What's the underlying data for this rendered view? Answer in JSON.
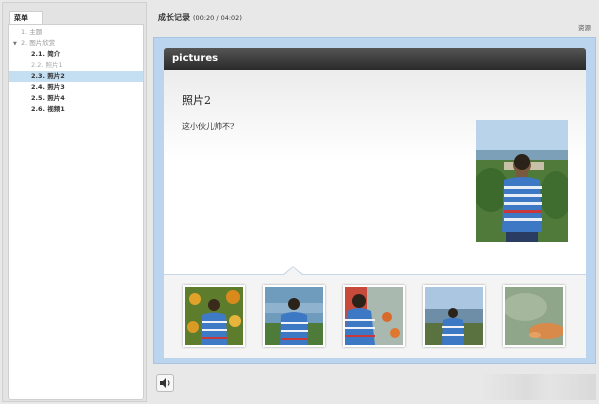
{
  "sidebar": {
    "menu_tab": "菜单",
    "items": [
      {
        "label": "1. 主题",
        "level": 0,
        "dim": true
      },
      {
        "label": "2. 图片欣赏",
        "level": 0,
        "dim": true,
        "expanded": true
      },
      {
        "label": "2.1. 简介",
        "level": 1
      },
      {
        "label": "2.2. 照片1",
        "level": 1,
        "dim": true
      },
      {
        "label": "2.3. 照片2",
        "level": 1,
        "active": true
      },
      {
        "label": "2.4. 照片3",
        "level": 1
      },
      {
        "label": "2.5. 照片4",
        "level": 1
      },
      {
        "label": "2.6. 视频1",
        "level": 1
      }
    ]
  },
  "header": {
    "title": "成长记录",
    "time": "(00:20 / 04:02)",
    "resources": "资源"
  },
  "slide": {
    "header_title": "pictures",
    "photo_title": "照片2",
    "caption": "这小伙儿帅不?"
  },
  "thumbnails": [
    {
      "scene": "garden-boy-flowers"
    },
    {
      "scene": "boy-lake-water"
    },
    {
      "scene": "boy-red-flowers-closeup"
    },
    {
      "scene": "boy-lakeside-distance"
    },
    {
      "scene": "pond-koi-fish"
    }
  ],
  "colors": {
    "stage_bg": "#bcd5ee",
    "active_item_bg": "#c4dff2",
    "header_dark": "#2a2a2a"
  },
  "icons": {
    "audio": "speaker-icon"
  }
}
